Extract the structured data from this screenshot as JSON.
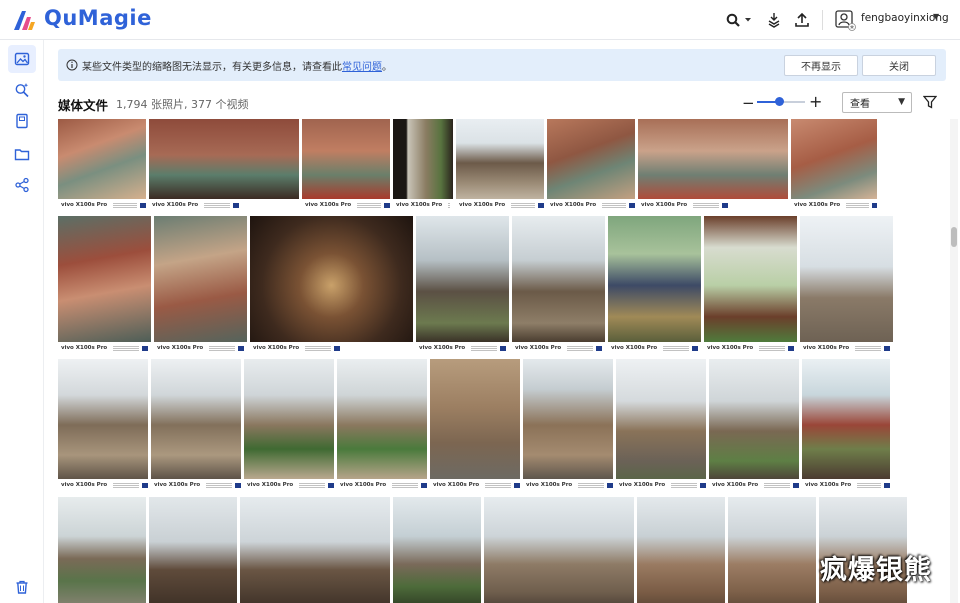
{
  "app": {
    "brand": "QuMagie"
  },
  "header": {
    "user_name": "fengbaoyinxiong"
  },
  "banner": {
    "message": "某些文件类型的缩略图无法显示，有关更多信息，请查看此",
    "link": "常见问题",
    "suffix": "。",
    "dismiss_label": "不再显示",
    "close_label": "关闭"
  },
  "toolbar": {
    "title": "媒体文件",
    "subtitle": "1,794 张照片, 377 个视频",
    "view_select": "查看",
    "zoom_level": 0.45
  },
  "photo_caption": "vivo X100s Pro",
  "watermark": "疯爆银熊",
  "colors": {
    "accent": "#2f62d8",
    "banner_bg": "#e3eefb"
  },
  "photos": [
    {
      "name": "mural-red-dragon",
      "bg": "linear-gradient(160deg,#9c5a44 0%,#c98b70 35%,#7a8f80 60%,#d6b08e 100%)"
    },
    {
      "name": "mural-woman-1",
      "bg": "linear-gradient(180deg,#8e4b3b 0%,#a76a55 45%,#5b7d6b 70%,#3b2a22 100%)"
    },
    {
      "name": "mural-woman-2",
      "bg": "linear-gradient(180deg,#a0644f 0%,#c07e62 40%,#6a7f6a 70%,#aa3a2c 100%)"
    },
    {
      "name": "window-view",
      "bg": "linear-gradient(90deg,#1b1714 0%,#1b1714 22%,#c9c4b8 25%,#8a7c62 55%,#58733f 80%,#2a231d 100%)"
    },
    {
      "name": "temple-hall",
      "bg": "linear-gradient(180deg,#e9eef2 0%,#dbe2e6 30%,#6c5a49 55%,#9b8b76 80%,#bfb3a1 100%)"
    },
    {
      "name": "mural-closeup-1",
      "bg": "linear-gradient(160deg,#b8785c 0%,#8f5742 40%,#6e8575 65%,#c4a081 100%)"
    },
    {
      "name": "mural-closeup-2",
      "bg": "linear-gradient(180deg,#a86f57 0%,#caa28a 40%,#6f7f73 70%,#b04c3a 100%)"
    },
    {
      "name": "mural-closeup-3",
      "bg": "linear-gradient(160deg,#c88a70 0%,#a65d45 45%,#7c8b7d 75%,#d5b397 100%)"
    },
    {
      "name": "mural-deity-1",
      "bg": "linear-gradient(170deg,#5b6f66 0%,#9c4e3c 35%,#c98e72 60%,#4d5e57 100%)"
    },
    {
      "name": "mural-deity-2",
      "bg": "linear-gradient(170deg,#6b7d72 0%,#c4a487 35%,#9a5a45 65%,#55645c 100%)"
    },
    {
      "name": "buddha-statues",
      "bg": "radial-gradient(circle at 50% 55%,#c9a16a 0%,#7a5234 30%,#3e2a1e 65%,#1e140f 100%)"
    },
    {
      "name": "pavilion-tree",
      "bg": "linear-gradient(180deg,#dfe6ea 0%,#b6c0c5 35%,#5b5044 60%,#6c7a4f 85%,#3a3228 100%)"
    },
    {
      "name": "courtyard",
      "bg": "linear-gradient(180deg,#e7ecef 0%,#c6ced2 35%,#6b5a48 60%,#8e7e68 85%,#4a3d30 100%)"
    },
    {
      "name": "heavenly-king",
      "bg": "linear-gradient(180deg,#7fa67d 0%,#a8c29b 30%,#3d4a66 55%,#a08a57 80%,#5a5f3b 100%)"
    },
    {
      "name": "map-board",
      "bg": "linear-gradient(180deg,#6b3f2b 0%,#d8dccf 25%,#b9cfa6 55%,#6b3f2b 80%,#4f7b3c 100%)"
    },
    {
      "name": "temple-wall",
      "bg": "linear-gradient(180deg,#eef2f5 0%,#d7dee3 40%,#8a7a68 65%,#6e6254 100%)"
    },
    {
      "name": "pagoda-1",
      "bg": "linear-gradient(180deg,#eef1f3 0%,#d3d8db 30%,#7e6c58 55%,#a8957c 80%,#5f5448 100%)"
    },
    {
      "name": "pagoda-2",
      "bg": "linear-gradient(180deg,#edf0f2 0%,#d0d6d9 30%,#82705b 55%,#ab987f 80%,#5d5348 100%)"
    },
    {
      "name": "pagoda-3",
      "bg": "linear-gradient(180deg,#e8ecee 0%,#cfd5d8 30%,#8a775f 55%,#3f6a32 75%,#b9a88f 100%)"
    },
    {
      "name": "pagoda-4",
      "bg": "linear-gradient(180deg,#eaeef0 0%,#cfd5d7 30%,#8b785f 55%,#4a7a3c 75%,#b6a48a 100%)"
    },
    {
      "name": "pagoda-wall",
      "bg": "linear-gradient(180deg,#b79c7d 0%,#9c7f62 40%,#7c6651 70%,#6d6a63 100%)"
    },
    {
      "name": "pagoda-5",
      "bg": "linear-gradient(180deg,#e4e9ec 0%,#c5cdd1 25%,#8b7258 55%,#a48b70 80%,#5e564d 100%)"
    },
    {
      "name": "pagoda-6",
      "bg": "linear-gradient(180deg,#eef1f3 0%,#d5dadd 35%,#8a7359 60%,#6b6257 85%,#5b6549 100%)"
    },
    {
      "name": "pagoda-7",
      "bg": "linear-gradient(180deg,#e9edef 0%,#cfd5d8 35%,#7a6853 60%,#5e7f45 85%,#4e4539 100%)"
    },
    {
      "name": "pagoda-8",
      "bg": "linear-gradient(180deg,#eaf0f3 0%,#c8d6dc 30%,#9a4638 55%,#6f7e4a 75%,#4b3b31 100%)"
    },
    {
      "name": "stairs-pagoda",
      "bg": "linear-gradient(180deg,#e7eced 0%,#ccd4d6 35%,#7a6a57 55%,#59744a 75%,#8a8476 100%)"
    },
    {
      "name": "church-roof-1",
      "bg": "linear-gradient(180deg,#e2e7ea 0%,#c9d0d4 40%,#5f4b3b 65%,#3c2f25 100%)"
    },
    {
      "name": "church-roof-2",
      "bg": "linear-gradient(180deg,#e6ebee 0%,#cdd4d8 40%,#6a5644 65%,#3d3027 100%)"
    },
    {
      "name": "church-trees",
      "bg": "linear-gradient(180deg,#e3e9ec 0%,#c4cfd4 35%,#7a6a5a 60%,#4d6b3a 80%,#2e3b23 100%)"
    },
    {
      "name": "church-gate",
      "bg": "linear-gradient(180deg,#e7ecef 0%,#cdd4d8 35%,#8e7b66 60%,#6f5e4d 85%,#4a3f35 100%)"
    },
    {
      "name": "church-front-1",
      "bg": "linear-gradient(180deg,#e4e9ec 0%,#c8d0d4 35%,#9a7b62 60%,#7a5c45 85%,#5b4636 100%)"
    },
    {
      "name": "church-front-2",
      "bg": "linear-gradient(180deg,#e6ebee 0%,#ccd3d7 35%,#9c7d64 60%,#7d6049 85%,#5d4837 100%)"
    },
    {
      "name": "church-front-3",
      "bg": "linear-gradient(180deg,#e6eaed 0%,#cbd2d6 35%,#9a7c63 60%,#7b5e48 85%,#5c4736 100%)"
    }
  ]
}
